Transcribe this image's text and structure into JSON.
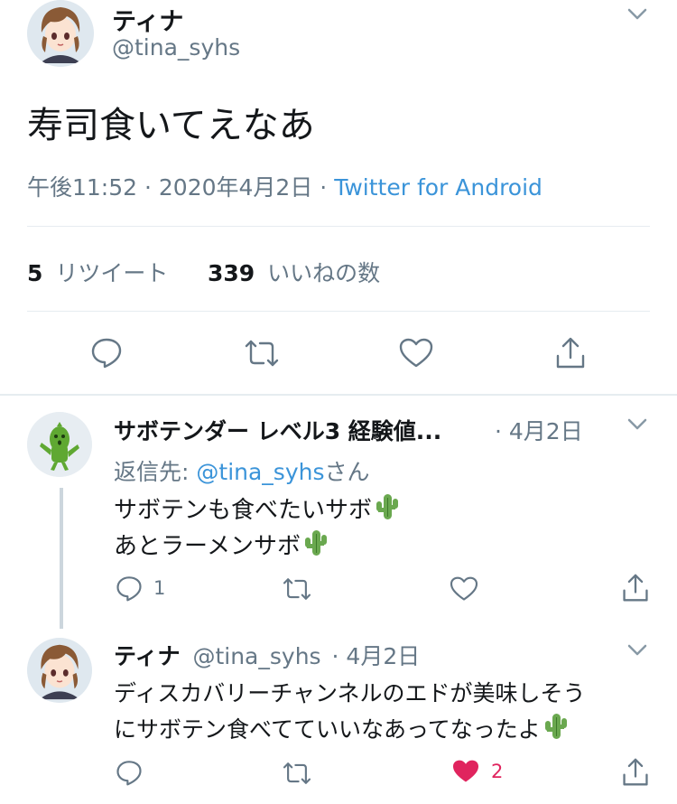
{
  "main_tweet": {
    "display_name": "ティナ",
    "handle": "@tina_syhs",
    "text": "寿司食いてえなあ",
    "time": "午後11:52",
    "date": "2020年4月2日",
    "source": "Twitter for Android",
    "retweets_count": "5",
    "retweets_label": "リツイート",
    "likes_count": "339",
    "likes_label": "いいねの数",
    "sep": "·"
  },
  "replies": [
    {
      "display_name": "サボテンダー レベル3 経験値...",
      "date": "· 4月2日",
      "reply_to_prefix": "返信先:",
      "reply_to_handle": "@tina_syhs",
      "reply_to_suffix": "さん",
      "line1": "サボテンも食べたいサボ",
      "line2": "あとラーメンサボ",
      "reply_count": "1",
      "like_count": ""
    },
    {
      "display_name": "ティナ",
      "handle": "@tina_syhs",
      "date": "· 4月2日",
      "line1": "ディスカバリーチャンネルのエドが美味しそう",
      "line2": "にサボテン食べてていいなあってなったよ",
      "like_count": "2",
      "liked": true
    }
  ],
  "colors": {
    "text": "#14171a",
    "muted": "#657786",
    "link": "#3b94d9",
    "like_red": "#e0245e",
    "divider": "#e6ecf0"
  },
  "icons": [
    "chevron-down-icon",
    "reply-icon",
    "retweet-icon",
    "like-icon",
    "share-icon",
    "cactus-emoji"
  ]
}
